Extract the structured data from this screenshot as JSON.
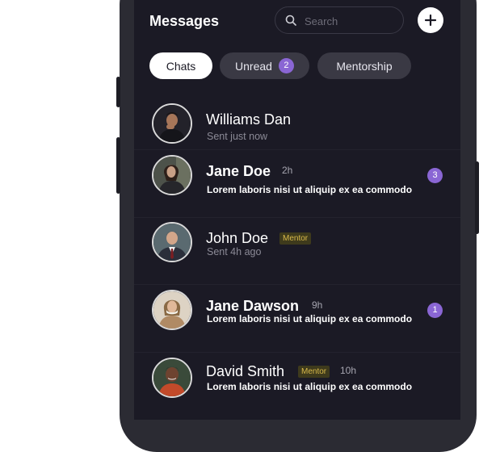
{
  "header": {
    "title": "Messages",
    "search_placeholder": "Search",
    "add_icon": "plus-icon"
  },
  "tabs": [
    {
      "label": "Chats",
      "active": true
    },
    {
      "label": "Unread",
      "badge": "2",
      "active": false
    },
    {
      "label": "Mentorship",
      "active": false
    }
  ],
  "conversations": [
    {
      "name": "Williams Dan",
      "subtitle": "Sent just now"
    },
    {
      "name": "Jane Doe",
      "time": "2h",
      "preview": "Lorem laboris nisi ut aliquip ex ea commodo",
      "unread": "3"
    },
    {
      "name": "John Doe",
      "tag": "Mentor",
      "subtitle": "Sent 4h ago"
    },
    {
      "name": "Jane Dawson",
      "time": "9h",
      "preview": "Lorem laboris nisi ut aliquip ex ea commodo",
      "unread": "1"
    },
    {
      "name": "David Smith",
      "tag": "Mentor",
      "time": "10h",
      "preview": "Lorem laboris nisi ut aliquip ex ea commodo"
    }
  ],
  "colors": {
    "screen_bg": "#1b1a25",
    "accent": "#8a66d4",
    "mentor_badge_bg": "#3e3a1c",
    "mentor_badge_text": "#d8b94a"
  }
}
